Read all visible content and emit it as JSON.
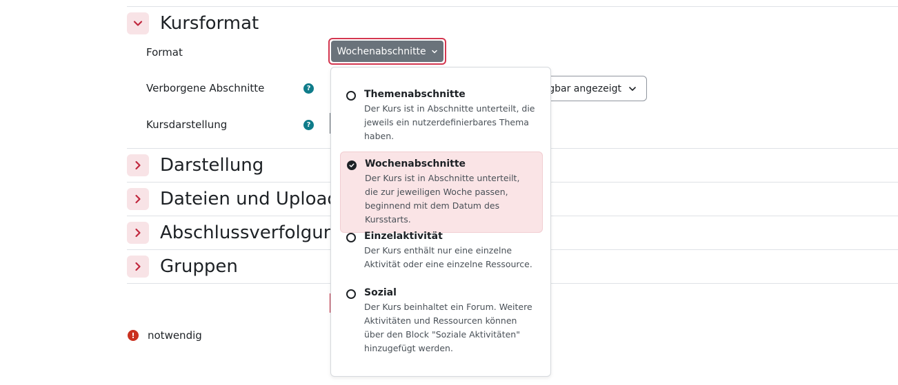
{
  "sections": {
    "kursformat": "Kursformat",
    "darstellung": "Darstellung",
    "dateien": "Dateien und Uploads",
    "abschluss": "Abschlussverfolgung",
    "gruppen": "Gruppen"
  },
  "fields": {
    "format_label": "Format",
    "verborgene_label": "Verborgene Abschnitte",
    "kursdarstellung_label": "Kursdarstellung",
    "help_glyph": "?"
  },
  "format_button": {
    "value": "Wochenabschnitte"
  },
  "verborgene_select": {
    "visible_value": "gbar angezeigt"
  },
  "dropdown": {
    "options": [
      {
        "title": "Themenabschnitte",
        "desc": "Der Kurs ist in Abschnitte unterteilt, die jeweils ein nutzerdefinierbares Thema haben.",
        "selected": false
      },
      {
        "title": "Wochenabschnitte",
        "desc": "Der Kurs ist in Abschnitte unterteilt, die zur jeweiligen Woche passen, beginnend mit dem Datum des Kursstarts.",
        "selected": true
      },
      {
        "title": "Einzelaktivität",
        "desc": "Der Kurs enthält nur eine einzelne Aktivität oder eine einzelne Ressource.",
        "selected": false
      },
      {
        "title": "Sozial",
        "desc": "Der Kurs beinhaltet ein Forum. Weitere Aktivitäten und Ressourcen können über den Block \"Soziale Aktivitäten\" hinzugefügt werden.",
        "selected": false
      }
    ]
  },
  "required": {
    "glyph": "!",
    "label": "notwendig"
  },
  "colors": {
    "accent": "#d3364f",
    "toggle_bg": "#f8e3e6",
    "help": "#0f7c8a",
    "required": "#ca3120",
    "button_gray": "#6a737b"
  }
}
